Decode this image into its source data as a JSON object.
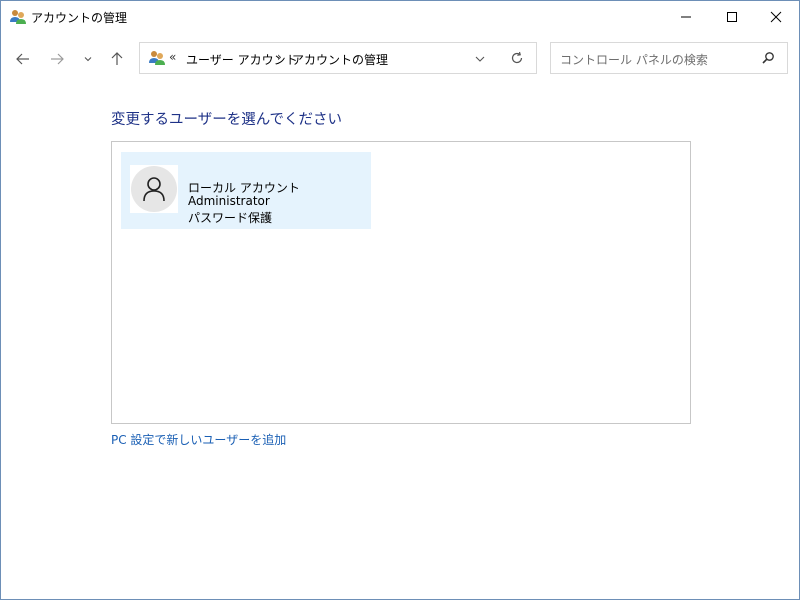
{
  "window": {
    "title": "アカウントの管理"
  },
  "navigation": {
    "overflow_chevron": "«",
    "breadcrumbs": [
      {
        "label": "ユーザー アカウント"
      },
      {
        "label": "アカウントの管理"
      }
    ],
    "separator": "›"
  },
  "search": {
    "placeholder": "コントロール パネルの検索"
  },
  "main": {
    "heading": "変更するユーザーを選んでください",
    "accounts": [
      {
        "name": "ローカル アカウント",
        "type": "Administrator",
        "status": "パスワード保護"
      }
    ],
    "add_user_link": "PC 設定で新しいユーザーを追加"
  },
  "colors": {
    "heading": "#1e3287",
    "link": "#1a5fb4",
    "tile_selected": "#e5f3fd"
  }
}
